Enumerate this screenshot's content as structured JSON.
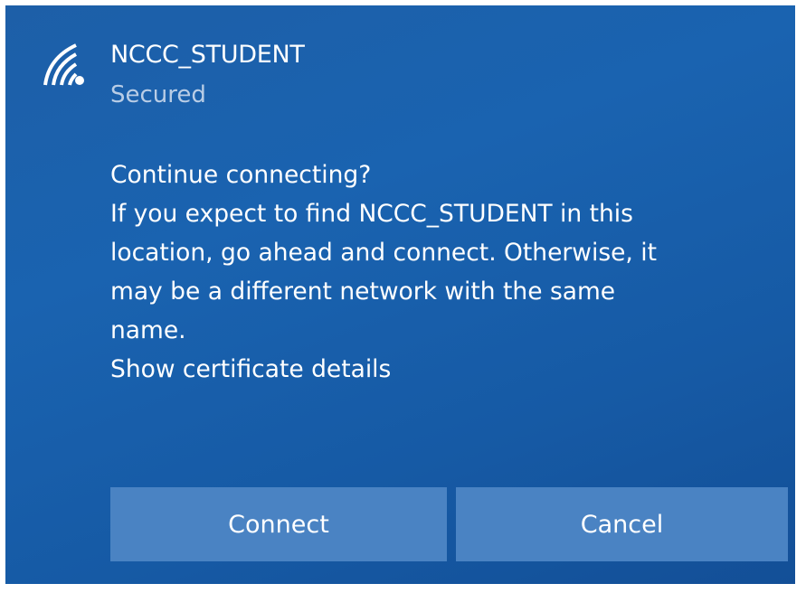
{
  "network": {
    "name": "NCCC_STUDENT",
    "status": "Secured",
    "icon": "wifi-secured-icon"
  },
  "prompt": {
    "heading": "Continue connecting?",
    "message_lines": [
      "If you expect to find NCCC_STUDENT in this",
      "location, go ahead and connect. Otherwise, it",
      "may be a different network with the same",
      "name."
    ],
    "link": "Show certificate details"
  },
  "buttons": {
    "connect_label": "Connect",
    "cancel_label": "Cancel"
  },
  "colors": {
    "background": "#1a63b0",
    "button": "#4a83c3",
    "secondary_text": "#b9cde6"
  }
}
